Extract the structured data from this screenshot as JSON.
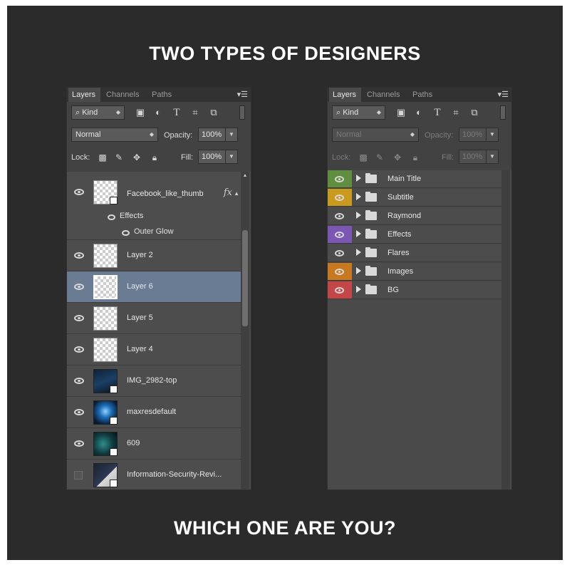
{
  "headings": {
    "top": "TWO TYPES OF DESIGNERS",
    "bottom": "WHICH ONE ARE YOU?"
  },
  "panel_left": {
    "tabs": [
      "Layers",
      "Channels",
      "Paths"
    ],
    "kind_label": "Kind",
    "blend_mode": "Normal",
    "opacity_label": "Opacity:",
    "opacity_value": "100%",
    "lock_label": "Lock:",
    "fill_label": "Fill:",
    "fill_value": "100%",
    "layers": [
      {
        "name": "Facebook_like_thumb",
        "visible": true,
        "fx": "fx",
        "effects_label": "Effects",
        "effect": "Outer Glow"
      },
      {
        "name": "Layer 2",
        "visible": true
      },
      {
        "name": "Layer 6",
        "visible": true,
        "selected": true
      },
      {
        "name": "Layer 5",
        "visible": true
      },
      {
        "name": "Layer 4",
        "visible": true
      },
      {
        "name": "IMG_2982-top",
        "visible": true
      },
      {
        "name": "maxresdefault",
        "visible": true
      },
      {
        "name": "609",
        "visible": true
      },
      {
        "name": "Information-Security-Revi...",
        "visible": false
      }
    ]
  },
  "panel_right": {
    "tabs": [
      "Layers",
      "Channels",
      "Paths"
    ],
    "kind_label": "Kind",
    "blend_mode": "Normal",
    "opacity_label": "Opacity:",
    "opacity_value": "100%",
    "lock_label": "Lock:",
    "fill_label": "Fill:",
    "fill_value": "100%",
    "groups": [
      {
        "name": "Main Title",
        "color": "#5f8f3e"
      },
      {
        "name": "Subtitle",
        "color": "#c99a1e"
      },
      {
        "name": "Raymond",
        "color": "#4c4c4c"
      },
      {
        "name": "Effects",
        "color": "#7b56b3"
      },
      {
        "name": "Flares",
        "color": "#4c4c4c"
      },
      {
        "name": "Images",
        "color": "#c8781e"
      },
      {
        "name": "BG",
        "color": "#c44646"
      }
    ]
  },
  "icons": {
    "search": "search-icon",
    "filter_pixel": "image-filter-icon",
    "filter_adjust": "adjustment-filter-icon",
    "filter_type": "type-filter-icon",
    "filter_shape": "shape-filter-icon",
    "filter_smart": "smart-object-filter-icon",
    "lock_transparent": "lock-transparent-pixels-icon",
    "lock_paint": "lock-image-pixels-icon",
    "lock_move": "lock-position-icon",
    "lock_all": "lock-all-icon",
    "panel_menu": "panel-menu-icon"
  }
}
